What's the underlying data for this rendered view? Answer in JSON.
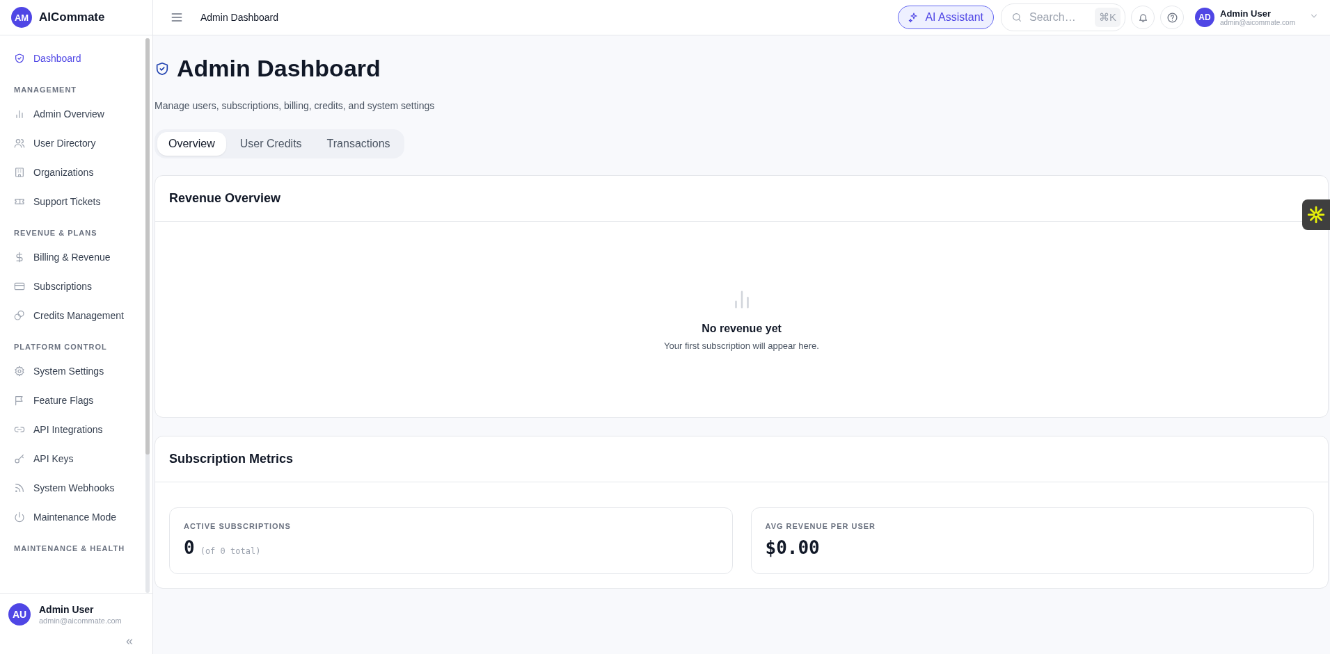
{
  "brand": {
    "logo": "AM",
    "name": "AICommate"
  },
  "sidebar": {
    "items": [
      {
        "label": "Dashboard",
        "selected": true
      }
    ],
    "sections": [
      {
        "title": "MANAGEMENT",
        "items": [
          {
            "label": "Admin Overview",
            "selected": false
          },
          {
            "label": "User Directory",
            "selected": false
          },
          {
            "label": "Organizations",
            "selected": false
          },
          {
            "label": "Support Tickets",
            "selected": false
          }
        ]
      },
      {
        "title": "REVENUE & PLANS",
        "items": [
          {
            "label": "Billing & Revenue",
            "selected": false
          },
          {
            "label": "Subscriptions",
            "selected": false
          },
          {
            "label": "Credits Management",
            "selected": false
          }
        ]
      },
      {
        "title": "PLATFORM CONTROL",
        "items": [
          {
            "label": "System Settings",
            "selected": false
          },
          {
            "label": "Feature Flags",
            "selected": false
          },
          {
            "label": "API Integrations",
            "selected": false
          },
          {
            "label": "API Keys",
            "selected": false
          },
          {
            "label": "System Webhooks",
            "selected": false
          },
          {
            "label": "Maintenance Mode",
            "selected": false
          }
        ]
      },
      {
        "title": "MAINTENANCE & HEALTH"
      }
    ],
    "user": {
      "avatar": "AU",
      "name": "Admin User",
      "email": "admin@aicommate.com"
    },
    "collapse": "«"
  },
  "topbar": {
    "title": "Admin Dashboard",
    "ai_button": "AI Assistant",
    "search": {
      "placeholder": "Search…",
      "shortcut": "⌘K"
    },
    "user": {
      "avatar": "AD",
      "name": "Admin User",
      "email": "admin@aicommate.com"
    }
  },
  "page": {
    "title": "Admin Dashboard",
    "subtitle": "Manage users, subscriptions, billing, credits, and system settings",
    "tabs": [
      {
        "label": "Overview",
        "selected": true
      },
      {
        "label": "User Credits",
        "selected": false
      },
      {
        "label": "Transactions",
        "selected": false
      }
    ],
    "revenue": {
      "title": "Revenue Overview",
      "empty_title": "No revenue yet",
      "empty_text": "Your first subscription will appear here."
    },
    "metrics": {
      "title": "Subscription Metrics",
      "cards": [
        {
          "label": "ACTIVE SUBSCRIPTIONS",
          "value": "0",
          "note": "(of 0 total)"
        },
        {
          "label": "AVG REVENUE PER USER",
          "value": "$0.00"
        }
      ]
    }
  }
}
